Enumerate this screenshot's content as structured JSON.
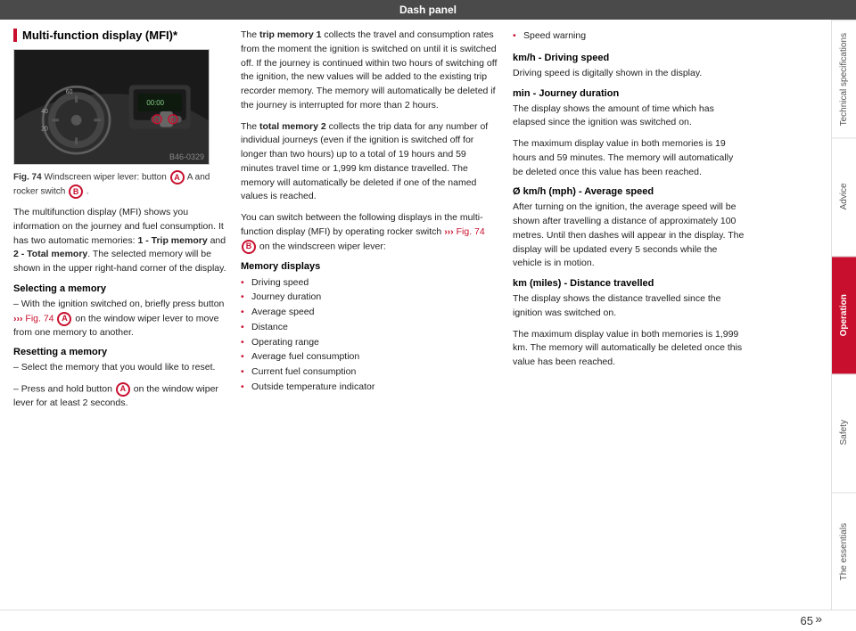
{
  "topbar": {
    "title": "Dash panel"
  },
  "left_col": {
    "section_title": "Multi-function display (MFI)*",
    "fig_number": "Fig. 74",
    "fig_caption_text": "Windscreen wiper lever: button",
    "fig_caption_a": "A",
    "fig_caption_end": " A and rocker switch",
    "fig_caption_b": "B",
    "fig_caption_dot": ".",
    "image_ref": "B46-0329",
    "body_intro": "The multifunction display (MFI) shows you information on the journey and fuel consumption. It has two automatic memories: ",
    "memory1": "1 - Trip memory",
    "body_mid": " and ",
    "memory2": "2 - Total memory",
    "body_end": ". The selected memory will be shown in the upper right-hand corner of the display.",
    "selecting_heading": "Selecting a memory",
    "selecting_text": "– With the ignition switched on, briefly press button",
    "selecting_fig": "Fig. 74",
    "selecting_a": "A",
    "selecting_end": " on the window wiper lever to move from one memory to another.",
    "resetting_heading": "Resetting a memory",
    "reset_step1": "– Select the memory that you would like to reset.",
    "reset_step2": "– Press and hold button",
    "reset_step2_a": "A",
    "reset_step2_end": " on the window wiper lever for at least 2 seconds."
  },
  "middle_col": {
    "trip_memory_intro": "The ",
    "trip_memory_bold": "trip memory 1",
    "trip_memory_text": " collects the travel and consumption rates from the moment the ignition is switched on until it is switched off. If the journey is continued within two hours of switching off the ignition, the new values will be added to the existing trip recorder memory. The memory will automatically be deleted if the journey is interrupted for more than 2 hours.",
    "total_memory_intro": "The ",
    "total_memory_bold": "total memory 2",
    "total_memory_text": " collects the trip data for any number of individual journeys (even if the ignition is switched off for longer than two hours) up to a total of 19 hours and 59 minutes travel time or 1,999 km distance travelled. The memory will automatically be deleted if one of the named values is reached.",
    "switch_text": "You can switch between the following displays in the multi-function display (MFI) by operating rocker switch",
    "switch_fig": "Fig. 74",
    "switch_b": "B",
    "switch_end": " on the windscreen wiper lever:",
    "memory_displays_heading": "Memory displays",
    "bullet_items": [
      "Driving speed",
      "Journey duration",
      "Average speed",
      "Distance",
      "Operating range",
      "Average fuel consumption",
      "Current fuel consumption",
      "Outside temperature indicator"
    ]
  },
  "right_col": {
    "speed_warning_bullet": "Speed warning",
    "kmh_heading": "km/h - Driving speed",
    "kmh_text": "Driving speed is digitally shown in the display.",
    "min_heading": "min - Journey duration",
    "min_text": "The display shows the amount of time which has elapsed since the ignition was switched on.",
    "min_text2": "The maximum display value in both memories is 19 hours and 59 minutes. The memory will automatically be deleted once this value has been reached.",
    "avg_heading": "Ø km/h (mph) - Average speed",
    "avg_text": "After turning on the ignition, the average speed will be shown after travelling a distance of approximately 100 metres. Until then dashes will appear in the display. The display will be updated every 5 seconds while the vehicle is in motion.",
    "km_heading": "km (miles) - Distance travelled",
    "km_text": "The display shows the distance travelled since the ignition was switched on.",
    "km_text2": "The maximum display value in both memories is 1,999 km. The memory will automatically be deleted once this value has been reached."
  },
  "sidebar_tabs": [
    {
      "label": "Technical specifications",
      "active": false
    },
    {
      "label": "Advice",
      "active": false
    },
    {
      "label": "Operation",
      "active": true
    },
    {
      "label": "Safety",
      "active": false
    },
    {
      "label": "The essentials",
      "active": false
    }
  ],
  "page_number": "65",
  "arrows": "»"
}
